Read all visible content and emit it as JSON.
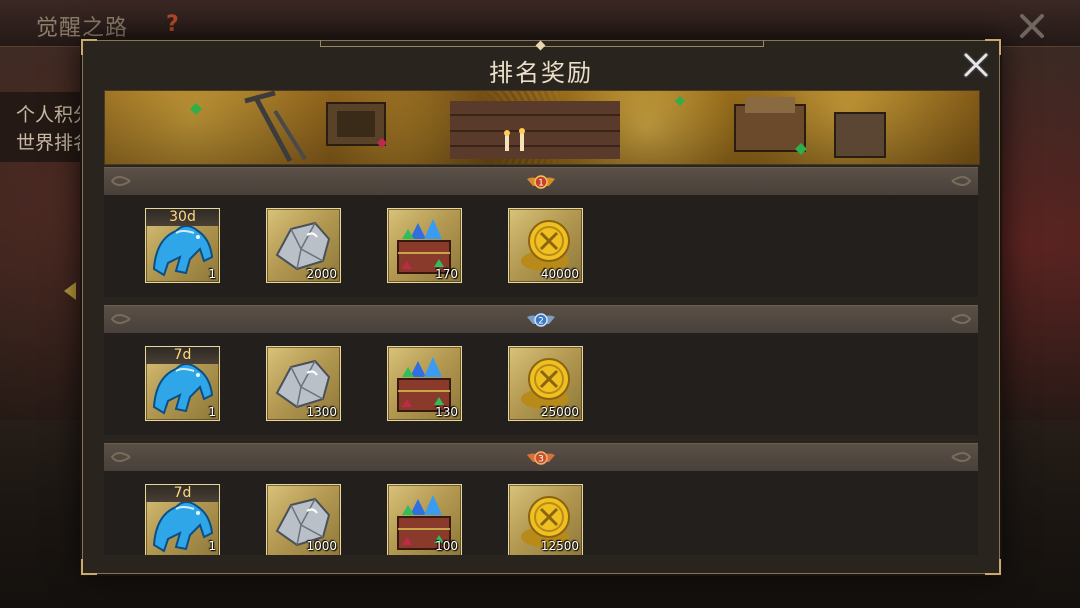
{
  "background": {
    "title": "觉醒之路",
    "help": "?",
    "left_lines": [
      "个人积分",
      "世界排名"
    ],
    "close_icon": "close-icon"
  },
  "dialog": {
    "title": "排名奖励",
    "close_icon": "close-icon"
  },
  "colors": {
    "title": "#eadfc8",
    "gold_tile": "#c4aa5e",
    "duration": "#ffd884",
    "rank1": "#c9402a",
    "rank2": "#3a78c8",
    "rank3": "#c8502a"
  },
  "tiers": [
    {
      "rank": "1",
      "rewards": [
        {
          "icon": "spectral-horse-icon",
          "duration": "30d",
          "qty": "1"
        },
        {
          "icon": "silver-ore-icon",
          "qty": "2000"
        },
        {
          "icon": "gem-chest-icon",
          "qty": "170"
        },
        {
          "icon": "gold-coin-icon",
          "qty": "40000"
        }
      ]
    },
    {
      "rank": "2",
      "rewards": [
        {
          "icon": "spectral-horse-icon",
          "duration": "7d",
          "qty": "1"
        },
        {
          "icon": "silver-ore-icon",
          "qty": "1300"
        },
        {
          "icon": "gem-chest-icon",
          "qty": "130"
        },
        {
          "icon": "gold-coin-icon",
          "qty": "25000"
        }
      ]
    },
    {
      "rank": "3",
      "rewards": [
        {
          "icon": "spectral-horse-icon",
          "duration": "7d",
          "qty": "1"
        },
        {
          "icon": "silver-ore-icon",
          "qty": "1000"
        },
        {
          "icon": "gem-chest-icon",
          "qty": "100"
        },
        {
          "icon": "gold-coin-icon",
          "qty": "12500"
        }
      ]
    }
  ]
}
